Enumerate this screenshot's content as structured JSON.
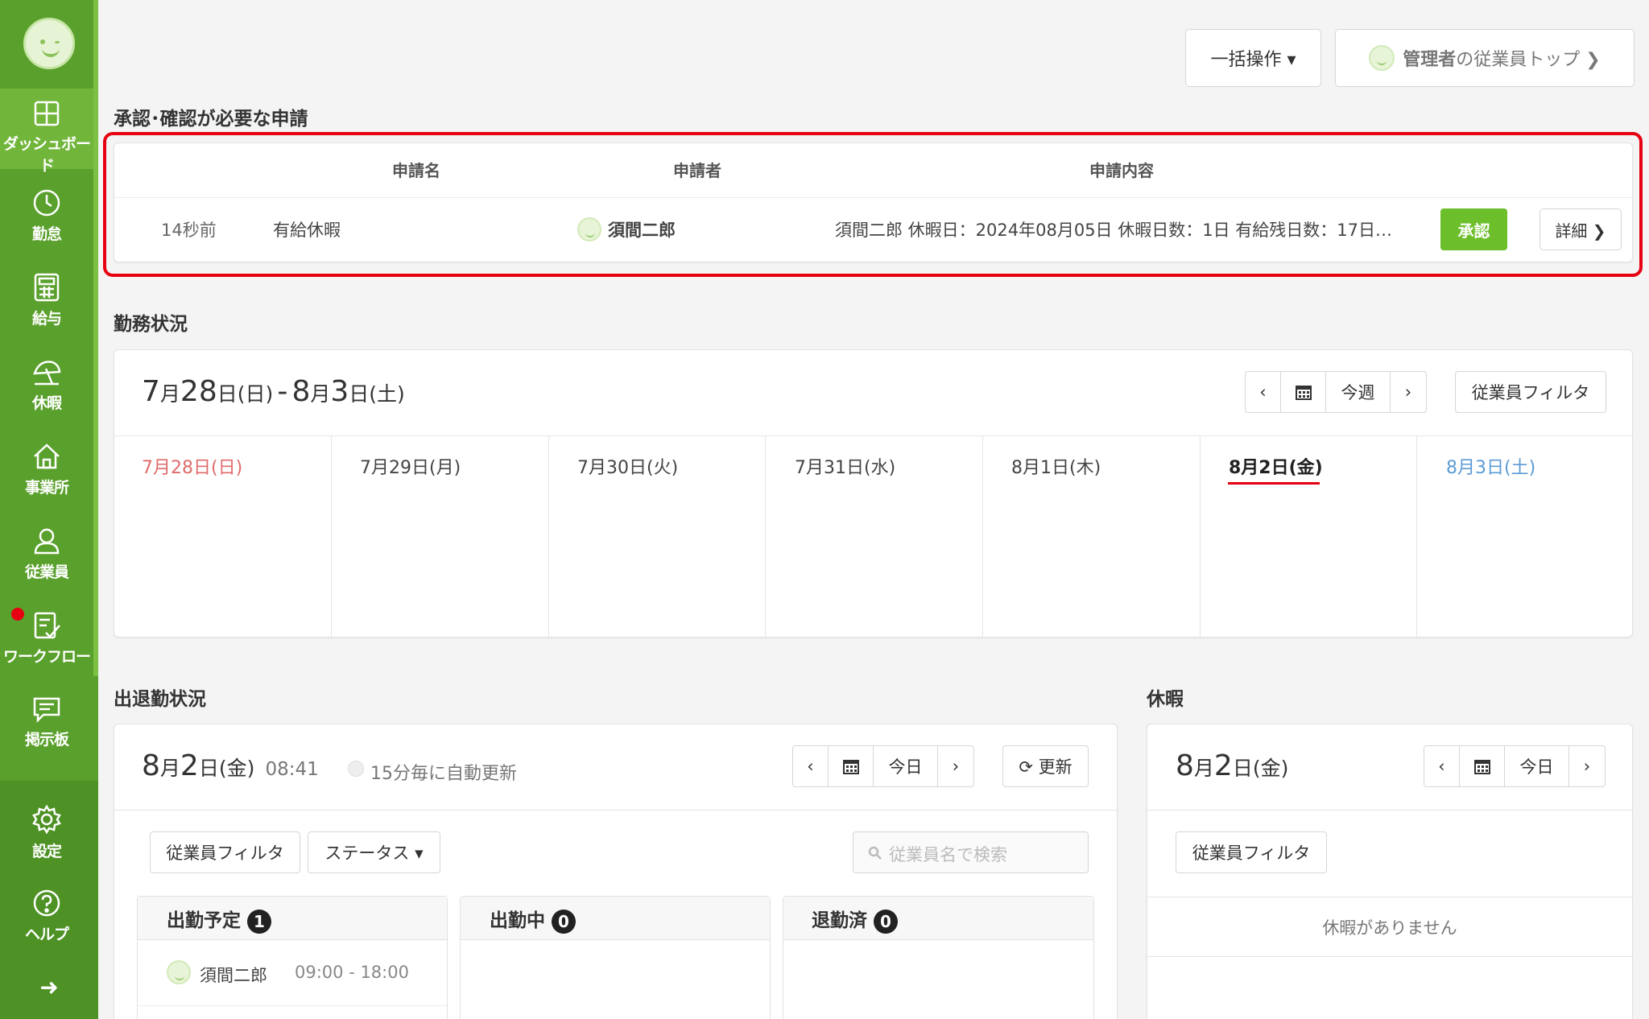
{
  "sidebar": {
    "items": [
      {
        "label": "ダッシュボード",
        "icon": "dashboard-icon"
      },
      {
        "label": "勤怠",
        "icon": "clock-icon"
      },
      {
        "label": "給与",
        "icon": "calculator-icon"
      },
      {
        "label": "休暇",
        "icon": "umbrella-icon"
      },
      {
        "label": "事業所",
        "icon": "home-icon"
      },
      {
        "label": "従業員",
        "icon": "person-icon"
      },
      {
        "label": "ワークフロー",
        "icon": "checklist-icon"
      },
      {
        "label": "掲示板",
        "icon": "chat-icon"
      },
      {
        "label": "設定",
        "icon": "gear-icon"
      },
      {
        "label": "ヘルプ",
        "icon": "help-icon"
      }
    ],
    "expand_glyph": "➜"
  },
  "topbar": {
    "bulk_label": "一括操作 ▾",
    "admin_top_strong": "管理者",
    "admin_top_rest": "の従業員トップ ❯"
  },
  "approval": {
    "title": "承認･確認が必要な申請",
    "headers": {
      "name": "申請名",
      "applicant": "申請者",
      "content": "申請内容"
    },
    "row": {
      "time": "14秒前",
      "name": "有給休暇",
      "applicant": "須間二郎",
      "content": "須間二郎 休暇日：2024年08月05日 休暇日数：1日 有給残日数：17日…",
      "approve": "承認",
      "detail": "詳細 ❯"
    }
  },
  "work_status": {
    "title": "勤務状況",
    "range": {
      "m1": "7",
      "d1": "28",
      "w1": "(日)",
      "m2": "8",
      "d2": "3",
      "w2": "(土)",
      "month_unit": "月",
      "day_unit": "日",
      "sep": "-"
    },
    "nav": {
      "prev": "‹",
      "today": "今週",
      "next": "›"
    },
    "filter": "従業員フィルタ",
    "days": [
      "7月28日(日)",
      "7月29日(月)",
      "7月30日(火)",
      "7月31日(水)",
      "8月1日(木)",
      "8月2日(金)",
      "8月3日(土)"
    ]
  },
  "attendance": {
    "title": "出退勤状況",
    "date": {
      "m": "8",
      "d": "2",
      "w": "(金)",
      "time": "08:41",
      "month_unit": "月",
      "day_unit": "日"
    },
    "auto_refresh": "15分毎に自動更新",
    "nav": {
      "prev": "‹",
      "today": "今日",
      "next": "›"
    },
    "refresh": "⟳ 更新",
    "filter": "従業員フィルタ",
    "status": "ステータス ▾",
    "search_placeholder": "従業員名で検索",
    "columns": [
      {
        "label": "出勤予定",
        "count": "1"
      },
      {
        "label": "出勤中",
        "count": "0"
      },
      {
        "label": "退勤済",
        "count": "0"
      }
    ],
    "scheduled": [
      {
        "name": "須間二郎",
        "time": "09:00 - 18:00"
      }
    ]
  },
  "vacation": {
    "title": "休暇",
    "date": {
      "m": "8",
      "d": "2",
      "w": "(金)",
      "month_unit": "月",
      "day_unit": "日"
    },
    "nav": {
      "prev": "‹",
      "today": "今日",
      "next": "›"
    },
    "filter": "従業員フィルタ",
    "empty": "休暇がありません"
  },
  "colors": {
    "sidebar": "#5aa02c",
    "approve": "#6cbf2a",
    "highlight": "#e60012",
    "sunday": "#e06a6a",
    "saturday": "#5b9bd5"
  }
}
